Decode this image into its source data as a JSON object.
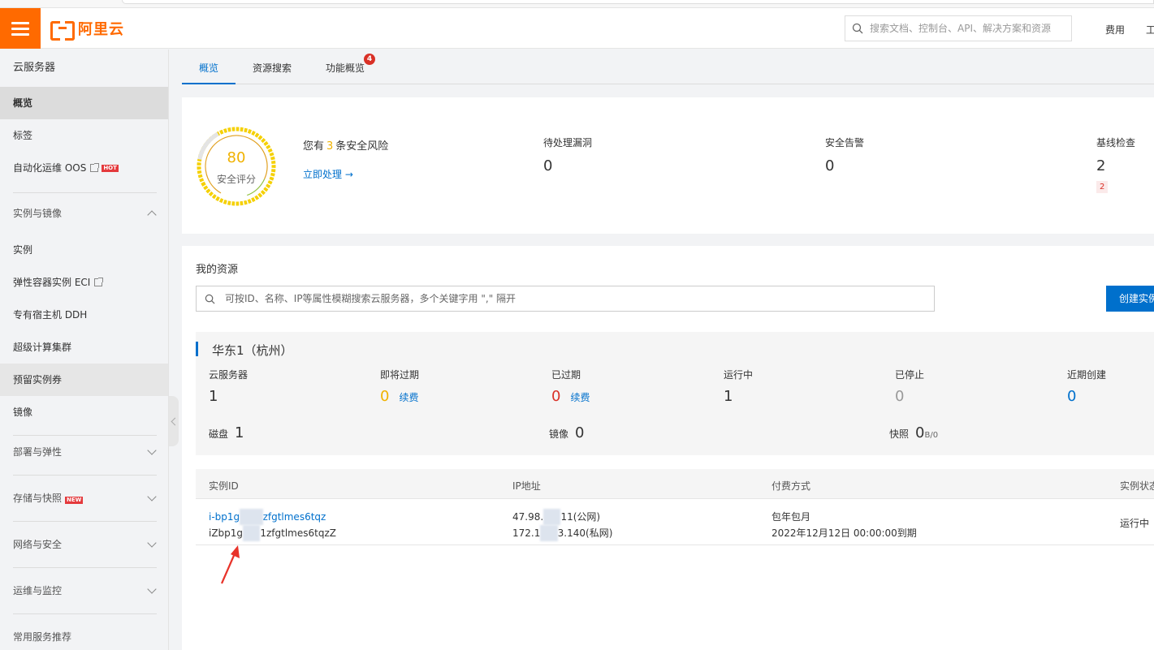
{
  "header": {
    "logo_text": "阿里云",
    "search_placeholder": "搜索文档、控制台、API、解决方案和资源",
    "links": [
      "费用",
      "工"
    ]
  },
  "sidebar": {
    "title": "云服务器",
    "items": [
      {
        "label": "概览"
      },
      {
        "label": "标签"
      },
      {
        "label": "自动化运维 OOS",
        "badge": "HOT"
      }
    ],
    "group_instances": {
      "label": "实例与镜像",
      "items": [
        {
          "label": "实例"
        },
        {
          "label": "弹性容器实例 ECI"
        },
        {
          "label": "专有宿主机 DDH"
        },
        {
          "label": "超级计算集群"
        },
        {
          "label": "预留实例券"
        },
        {
          "label": "镜像"
        }
      ]
    },
    "groups": [
      {
        "label": "部署与弹性"
      },
      {
        "label": "存储与快照",
        "badge": "NEW"
      },
      {
        "label": "网络与安全"
      },
      {
        "label": "运维与监控"
      },
      {
        "label": "常用服务推荐"
      }
    ]
  },
  "tabs": [
    {
      "label": "概览"
    },
    {
      "label": "资源搜索"
    },
    {
      "label": "功能概览",
      "badge": "4"
    }
  ],
  "security": {
    "score": "80",
    "score_label": "安全评分",
    "risk_prefix": "您有",
    "risk_count": "3",
    "risk_suffix": "条安全风险",
    "action": "立即处理 →",
    "stats": [
      {
        "label": "待处理漏洞",
        "value": "0"
      },
      {
        "label": "安全告警",
        "value": "0"
      },
      {
        "label": "基线检查",
        "value": "2",
        "sub": "2"
      }
    ]
  },
  "resources": {
    "title": "我的资源",
    "search_placeholder": "可按ID、名称、IP等属性模糊搜索云服务器，多个关键字用 \",\" 隔开",
    "create_button": "创建实例",
    "region": {
      "title": "华东1（杭州）",
      "stats": [
        {
          "label": "云服务器",
          "value": "1",
          "color": "#333333"
        },
        {
          "label": "即将过期",
          "value": "0",
          "color": "#f0b200",
          "renew": "续费"
        },
        {
          "label": "已过期",
          "value": "0",
          "color": "#d93026",
          "renew": "续费"
        },
        {
          "label": "运行中",
          "value": "1",
          "color": "#333333"
        },
        {
          "label": "已停止",
          "value": "0",
          "color": "#999999"
        },
        {
          "label": "近期创建",
          "value": "0",
          "color": "#0070cc"
        }
      ],
      "disk": {
        "label": "磁盘",
        "value": "1"
      },
      "image": {
        "label": "镜像",
        "value": "0"
      },
      "snapshot": {
        "label": "快照",
        "value": "0",
        "unit": "B/0"
      }
    },
    "table": {
      "columns": [
        "实例ID",
        "IP地址",
        "付费方式",
        "实例状态"
      ],
      "rows": [
        {
          "id_a": "i-bp1g",
          "id_b": "zfgtlmes6tqz",
          "name_a": "iZbp1g",
          "name_b": "1zfgtlmes6tqzZ",
          "ip_public_a": "47.98.",
          "ip_public_b": "11(公网)",
          "ip_private_a": "172.1",
          "ip_private_b": "3.140(私网)",
          "billing": "包年包月",
          "expire": "2022年12月12日 00:00:00到期",
          "status": "运行中"
        }
      ]
    }
  },
  "colors": {
    "brand": "#ff6a00",
    "link": "#0070cc",
    "warning": "#f0b200",
    "danger": "#d93026"
  }
}
